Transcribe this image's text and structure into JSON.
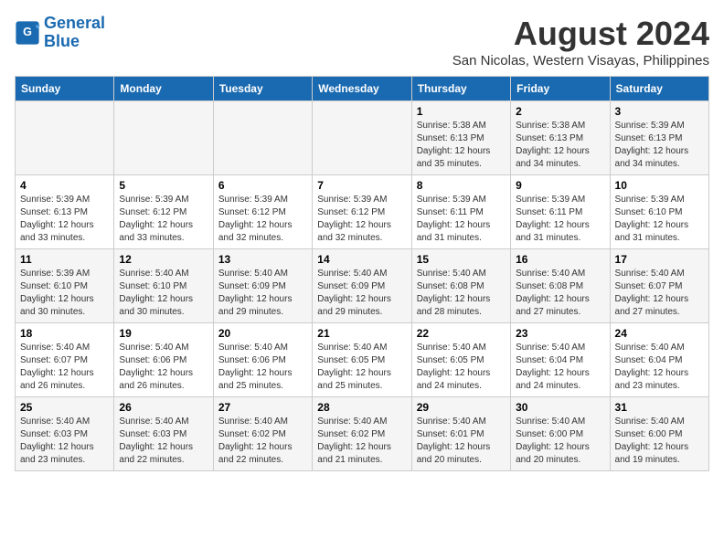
{
  "logo": {
    "line1": "General",
    "line2": "Blue"
  },
  "title": "August 2024",
  "subtitle": "San Nicolas, Western Visayas, Philippines",
  "headers": [
    "Sunday",
    "Monday",
    "Tuesday",
    "Wednesday",
    "Thursday",
    "Friday",
    "Saturday"
  ],
  "weeks": [
    [
      {
        "day": "",
        "info": ""
      },
      {
        "day": "",
        "info": ""
      },
      {
        "day": "",
        "info": ""
      },
      {
        "day": "",
        "info": ""
      },
      {
        "day": "1",
        "info": "Sunrise: 5:38 AM\nSunset: 6:13 PM\nDaylight: 12 hours\nand 35 minutes."
      },
      {
        "day": "2",
        "info": "Sunrise: 5:38 AM\nSunset: 6:13 PM\nDaylight: 12 hours\nand 34 minutes."
      },
      {
        "day": "3",
        "info": "Sunrise: 5:39 AM\nSunset: 6:13 PM\nDaylight: 12 hours\nand 34 minutes."
      }
    ],
    [
      {
        "day": "4",
        "info": "Sunrise: 5:39 AM\nSunset: 6:13 PM\nDaylight: 12 hours\nand 33 minutes."
      },
      {
        "day": "5",
        "info": "Sunrise: 5:39 AM\nSunset: 6:12 PM\nDaylight: 12 hours\nand 33 minutes."
      },
      {
        "day": "6",
        "info": "Sunrise: 5:39 AM\nSunset: 6:12 PM\nDaylight: 12 hours\nand 32 minutes."
      },
      {
        "day": "7",
        "info": "Sunrise: 5:39 AM\nSunset: 6:12 PM\nDaylight: 12 hours\nand 32 minutes."
      },
      {
        "day": "8",
        "info": "Sunrise: 5:39 AM\nSunset: 6:11 PM\nDaylight: 12 hours\nand 31 minutes."
      },
      {
        "day": "9",
        "info": "Sunrise: 5:39 AM\nSunset: 6:11 PM\nDaylight: 12 hours\nand 31 minutes."
      },
      {
        "day": "10",
        "info": "Sunrise: 5:39 AM\nSunset: 6:10 PM\nDaylight: 12 hours\nand 31 minutes."
      }
    ],
    [
      {
        "day": "11",
        "info": "Sunrise: 5:39 AM\nSunset: 6:10 PM\nDaylight: 12 hours\nand 30 minutes."
      },
      {
        "day": "12",
        "info": "Sunrise: 5:40 AM\nSunset: 6:10 PM\nDaylight: 12 hours\nand 30 minutes."
      },
      {
        "day": "13",
        "info": "Sunrise: 5:40 AM\nSunset: 6:09 PM\nDaylight: 12 hours\nand 29 minutes."
      },
      {
        "day": "14",
        "info": "Sunrise: 5:40 AM\nSunset: 6:09 PM\nDaylight: 12 hours\nand 29 minutes."
      },
      {
        "day": "15",
        "info": "Sunrise: 5:40 AM\nSunset: 6:08 PM\nDaylight: 12 hours\nand 28 minutes."
      },
      {
        "day": "16",
        "info": "Sunrise: 5:40 AM\nSunset: 6:08 PM\nDaylight: 12 hours\nand 27 minutes."
      },
      {
        "day": "17",
        "info": "Sunrise: 5:40 AM\nSunset: 6:07 PM\nDaylight: 12 hours\nand 27 minutes."
      }
    ],
    [
      {
        "day": "18",
        "info": "Sunrise: 5:40 AM\nSunset: 6:07 PM\nDaylight: 12 hours\nand 26 minutes."
      },
      {
        "day": "19",
        "info": "Sunrise: 5:40 AM\nSunset: 6:06 PM\nDaylight: 12 hours\nand 26 minutes."
      },
      {
        "day": "20",
        "info": "Sunrise: 5:40 AM\nSunset: 6:06 PM\nDaylight: 12 hours\nand 25 minutes."
      },
      {
        "day": "21",
        "info": "Sunrise: 5:40 AM\nSunset: 6:05 PM\nDaylight: 12 hours\nand 25 minutes."
      },
      {
        "day": "22",
        "info": "Sunrise: 5:40 AM\nSunset: 6:05 PM\nDaylight: 12 hours\nand 24 minutes."
      },
      {
        "day": "23",
        "info": "Sunrise: 5:40 AM\nSunset: 6:04 PM\nDaylight: 12 hours\nand 24 minutes."
      },
      {
        "day": "24",
        "info": "Sunrise: 5:40 AM\nSunset: 6:04 PM\nDaylight: 12 hours\nand 23 minutes."
      }
    ],
    [
      {
        "day": "25",
        "info": "Sunrise: 5:40 AM\nSunset: 6:03 PM\nDaylight: 12 hours\nand 23 minutes."
      },
      {
        "day": "26",
        "info": "Sunrise: 5:40 AM\nSunset: 6:03 PM\nDaylight: 12 hours\nand 22 minutes."
      },
      {
        "day": "27",
        "info": "Sunrise: 5:40 AM\nSunset: 6:02 PM\nDaylight: 12 hours\nand 22 minutes."
      },
      {
        "day": "28",
        "info": "Sunrise: 5:40 AM\nSunset: 6:02 PM\nDaylight: 12 hours\nand 21 minutes."
      },
      {
        "day": "29",
        "info": "Sunrise: 5:40 AM\nSunset: 6:01 PM\nDaylight: 12 hours\nand 20 minutes."
      },
      {
        "day": "30",
        "info": "Sunrise: 5:40 AM\nSunset: 6:00 PM\nDaylight: 12 hours\nand 20 minutes."
      },
      {
        "day": "31",
        "info": "Sunrise: 5:40 AM\nSunset: 6:00 PM\nDaylight: 12 hours\nand 19 minutes."
      }
    ]
  ]
}
